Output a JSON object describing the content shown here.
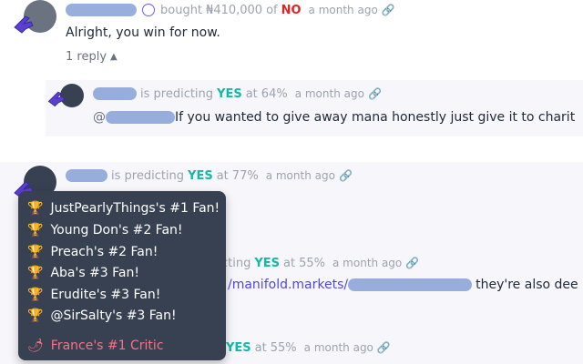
{
  "comments": [
    {
      "action": "bought",
      "amount": "₦410,000",
      "of_word": "of",
      "outcome": "NO",
      "time": "a month ago",
      "text": "Alright, you win for now.",
      "reply_label": "1 reply"
    },
    {
      "action": "is predicting",
      "outcome": "YES",
      "at_word": "at",
      "prob": "64%",
      "time": "a month ago",
      "mention": "@",
      "text": "If you wanted to give away mana honestly just give it to charit"
    },
    {
      "action": "is predicting",
      "outcome": "YES",
      "at_word": "at",
      "prob": "77%",
      "time": "a month ago"
    },
    {
      "action_partial": "cting",
      "outcome": "YES",
      "at_word": "at",
      "prob": "55%",
      "time": "a month ago",
      "link_text": "/manifold.markets/",
      "text": "they're also dee"
    },
    {
      "outcome": "YES",
      "at_word": "at",
      "prob": "55%",
      "time": "a month ago"
    }
  ],
  "tooltip": {
    "items": [
      {
        "label": "JustPearlyThings's #1 Fan!",
        "icon": "gold-trophy-icon"
      },
      {
        "label": "Young Don's #2 Fan!",
        "icon": "trophy-icon"
      },
      {
        "label": "Preach's #2 Fan!",
        "icon": "trophy-icon"
      },
      {
        "label": "Aba's #3 Fan!",
        "icon": "trophy-icon"
      },
      {
        "label": "Erudite's #3 Fan!",
        "icon": "trophy-icon"
      },
      {
        "label": "@SirSalty's #3 Fan!",
        "icon": "trophy-icon"
      },
      {
        "label": "France's #1 Critic",
        "icon": "chili-pepper-icon"
      }
    ]
  },
  "colors": {
    "yes": "#14b8a6",
    "no": "#dc2626",
    "tooltip_bg": "#374151",
    "critic": "#fb7185",
    "hand": "#5b3fd1"
  }
}
